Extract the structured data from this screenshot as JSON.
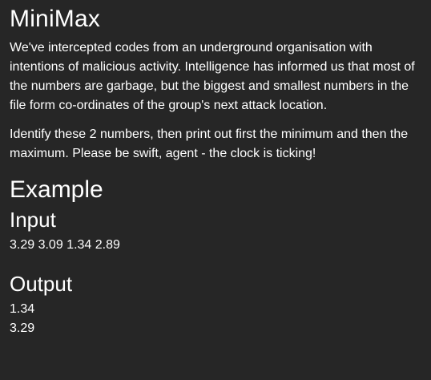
{
  "title": "MiniMax",
  "description": {
    "paragraph1": "We've intercepted codes from an underground organisation with intentions of malicious activity. Intelligence has informed us that most of the numbers are garbage, but the biggest and smallest numbers in the file form co-ordinates of the group's next attack location.",
    "paragraph2": "Identify these 2 numbers, then print out first the minimum and then the maximum. Please be swift, agent - the clock is ticking!"
  },
  "example": {
    "heading": "Example",
    "input_heading": "Input",
    "input_lines": [
      "3.29 3.09 1.34 2.89"
    ],
    "output_heading": "Output",
    "output_lines": [
      "1.34",
      "3.29"
    ]
  }
}
